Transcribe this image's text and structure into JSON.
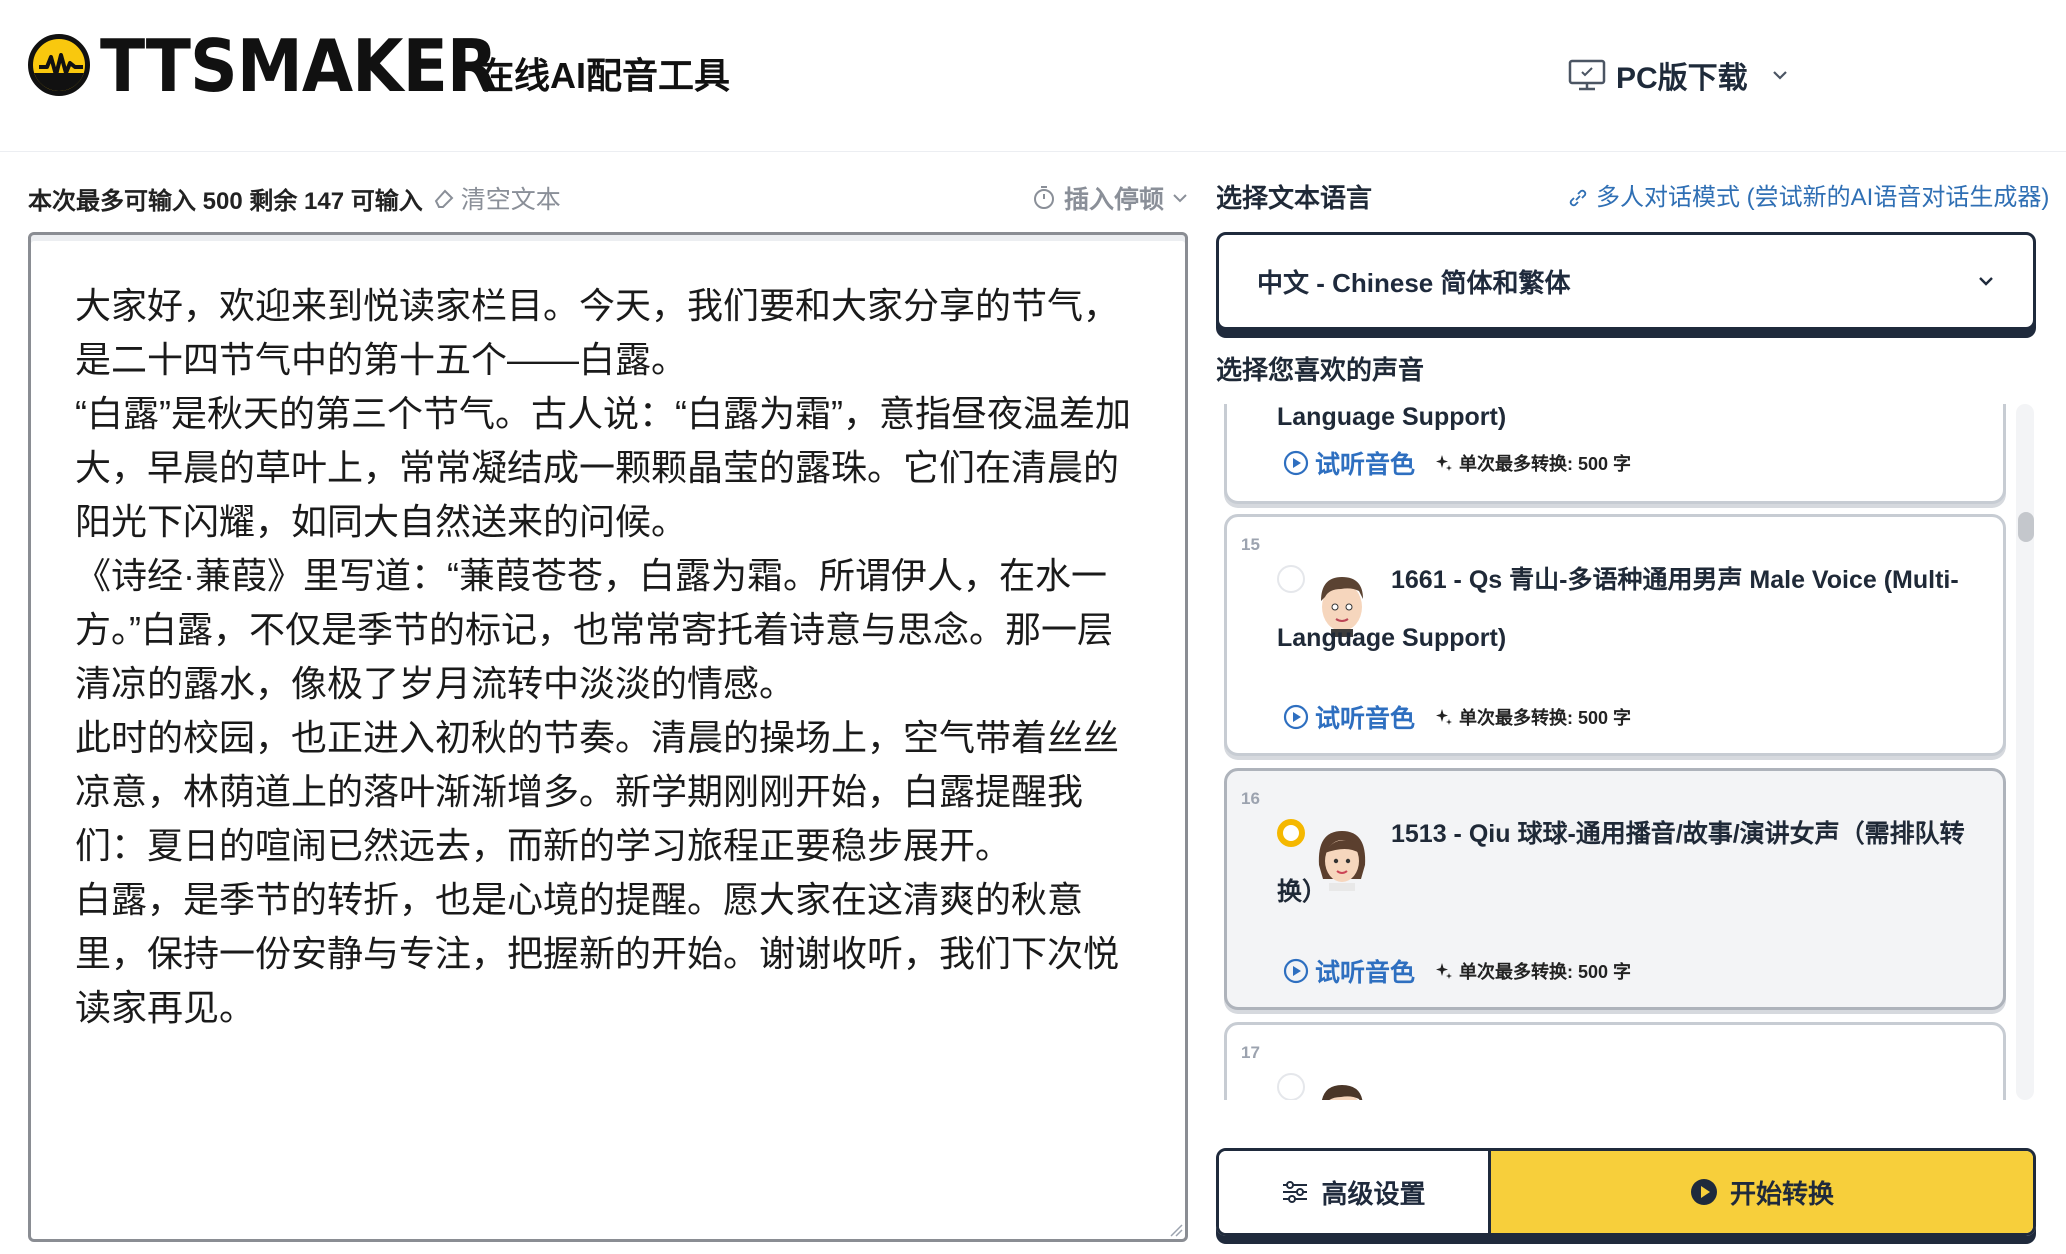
{
  "header": {
    "logo_text": "TTSMAKER",
    "tagline": "在线AI配音工具",
    "pc_download": "PC版下载"
  },
  "editor": {
    "limit_text": "本次最多可输入 500 剩余 147 可输入",
    "clear_label": "清空文本",
    "pause_label": "插入停顿",
    "content": "大家好，欢迎来到悦读家栏目。今天，我们要和大家分享的节气，\n是二十四节气中的第十五个——白露。\n“白露”是秋天的第三个节气。古人说：“白露为霜”，意指昼夜温差加\n大，早晨的草叶上，常常凝结成一颗颗晶莹的露珠。它们在清晨的\n阳光下闪耀，如同大自然送来的问候。\n《诗经·蒹葭》里写道：“蒹葭苍苍，白露为霜。所谓伊人，在水一\n方。”白露，不仅是季节的标记，也常常寄托着诗意与思念。那一层\n清凉的露水，像极了岁月流转中淡淡的情感。\n此时的校园，也正进入初秋的节奏。清晨的操场上，空气带着丝丝\n凉意，林荫道上的落叶渐渐增多。新学期刚刚开始，白露提醒我\n们：夏日的喧闹已然远去，而新的学习旅程正要稳步展开。\n白露，是季节的转折，也是心境的提醒。愿大家在这清爽的秋意\n里，保持一份安静与专注，把握新的开始。谢谢收听，我们下次悦\n读家再见。"
  },
  "language": {
    "label": "选择文本语言",
    "multi_link": "多人对话模式 (尝试新的AI语音对话生成器)",
    "selected": "中文 - Chinese 简体和繁体"
  },
  "voices": {
    "label": "选择您喜欢的声音",
    "listen_label": "试听音色",
    "limit_label": "单次最多转换: 500 字",
    "items": [
      {
        "num": "",
        "name": "Language Support)",
        "selected": false
      },
      {
        "num": "15",
        "name": "1661 - Qs 青山-多语种通用男声 Male Voice (Multi-Language Support)",
        "selected": false
      },
      {
        "num": "16",
        "name": "1513 - Qiu 球球-通用播音/故事/演讲女声（需排队转换）",
        "selected": true
      },
      {
        "num": "17",
        "name": "",
        "selected": false
      }
    ]
  },
  "actions": {
    "advanced": "高级设置",
    "start": "开始转换"
  },
  "colors": {
    "brand_yellow": "#f7cf3b",
    "navy": "#1f2a3c",
    "link_blue": "#2e6fc0"
  }
}
